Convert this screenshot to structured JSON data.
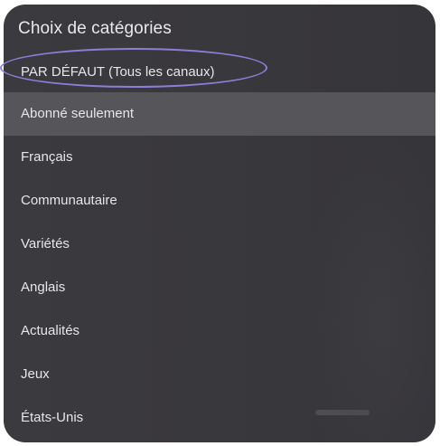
{
  "panel": {
    "title": "Choix de catégories"
  },
  "menu": {
    "items": [
      {
        "label": "PAR DÉFAUT (Tous les canaux)"
      },
      {
        "label": "Abonné seulement"
      },
      {
        "label": "Français"
      },
      {
        "label": "Communautaire"
      },
      {
        "label": "Variétés"
      },
      {
        "label": "Anglais"
      },
      {
        "label": "Actualités"
      },
      {
        "label": "Jeux"
      },
      {
        "label": "États-Unis"
      }
    ],
    "selected_index": 1
  },
  "colors": {
    "panel_bg": "#3a393d",
    "highlight_bg": "#56555a",
    "text": "#e6e6ea",
    "annotation_circle": "#8c7fd9"
  }
}
